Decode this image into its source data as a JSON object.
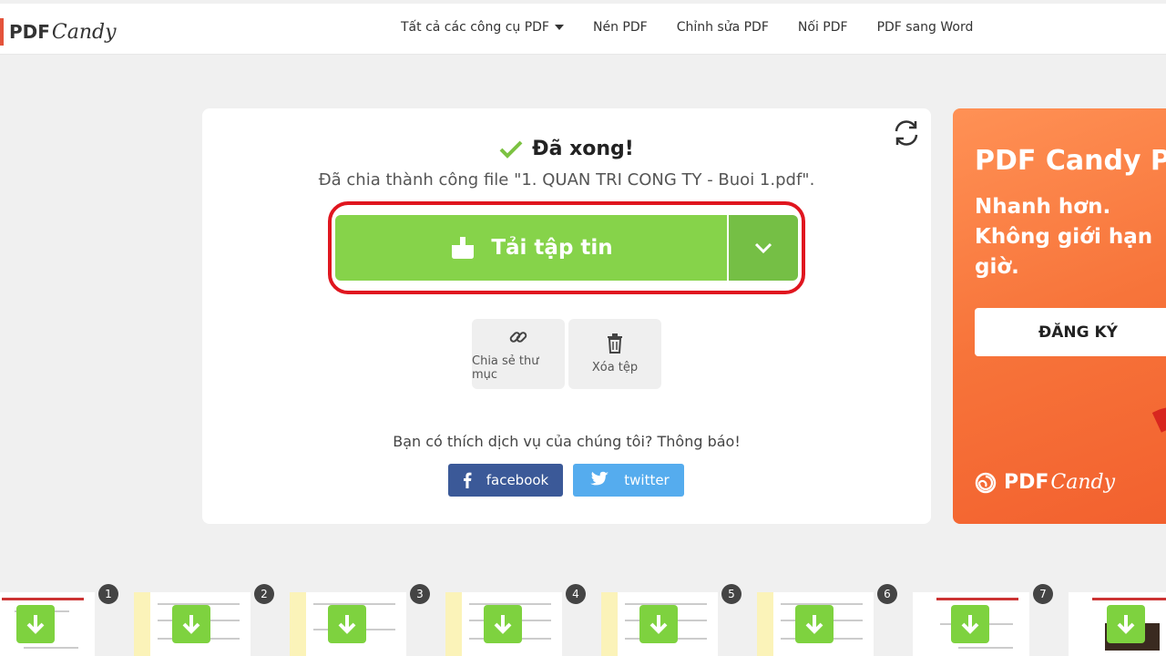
{
  "header": {
    "logo_pdf": "PDF",
    "logo_candy": "Candy",
    "nav": [
      {
        "label": "Tất cả các công cụ PDF",
        "has_caret": true
      },
      {
        "label": "Nén PDF"
      },
      {
        "label": "Chỉnh sửa PDF"
      },
      {
        "label": "Nối PDF"
      },
      {
        "label": "PDF sang Word"
      }
    ]
  },
  "result": {
    "title": "Đã xong!",
    "message": "Đã chia thành công file \"1. QUAN TRI CONG TY - Buoi 1.pdf\".",
    "download_label": "Tải tập tin",
    "share_label": "Chia sẻ thư mục",
    "delete_label": "Xóa tệp",
    "rate_question": "Bạn có thích dịch vụ của chúng tôi? Thông báo!",
    "facebook_label": "facebook",
    "twitter_label": "twitter"
  },
  "promo": {
    "title": "PDF Candy PRO",
    "subtitle": "Nhanh hơn. Không giới hạn giờ.",
    "cta": "ĐĂNG KÝ",
    "logo_pdf": "PDF",
    "logo_candy": "Candy"
  },
  "thumbnails": [
    "1",
    "2",
    "3",
    "4",
    "5",
    "6",
    "7"
  ],
  "colors": {
    "accent_green": "#86d34a",
    "highlight_red": "#e0161f",
    "facebook": "#3b5998",
    "twitter": "#55acee",
    "promo_orange": "#f7743a"
  },
  "icons": {
    "check": "check-icon",
    "download": "download-icon",
    "chevron": "chevron-down-icon",
    "link": "link-icon",
    "trash": "trash-icon",
    "refresh": "refresh-icon",
    "facebook": "facebook-icon",
    "twitter": "twitter-icon"
  }
}
